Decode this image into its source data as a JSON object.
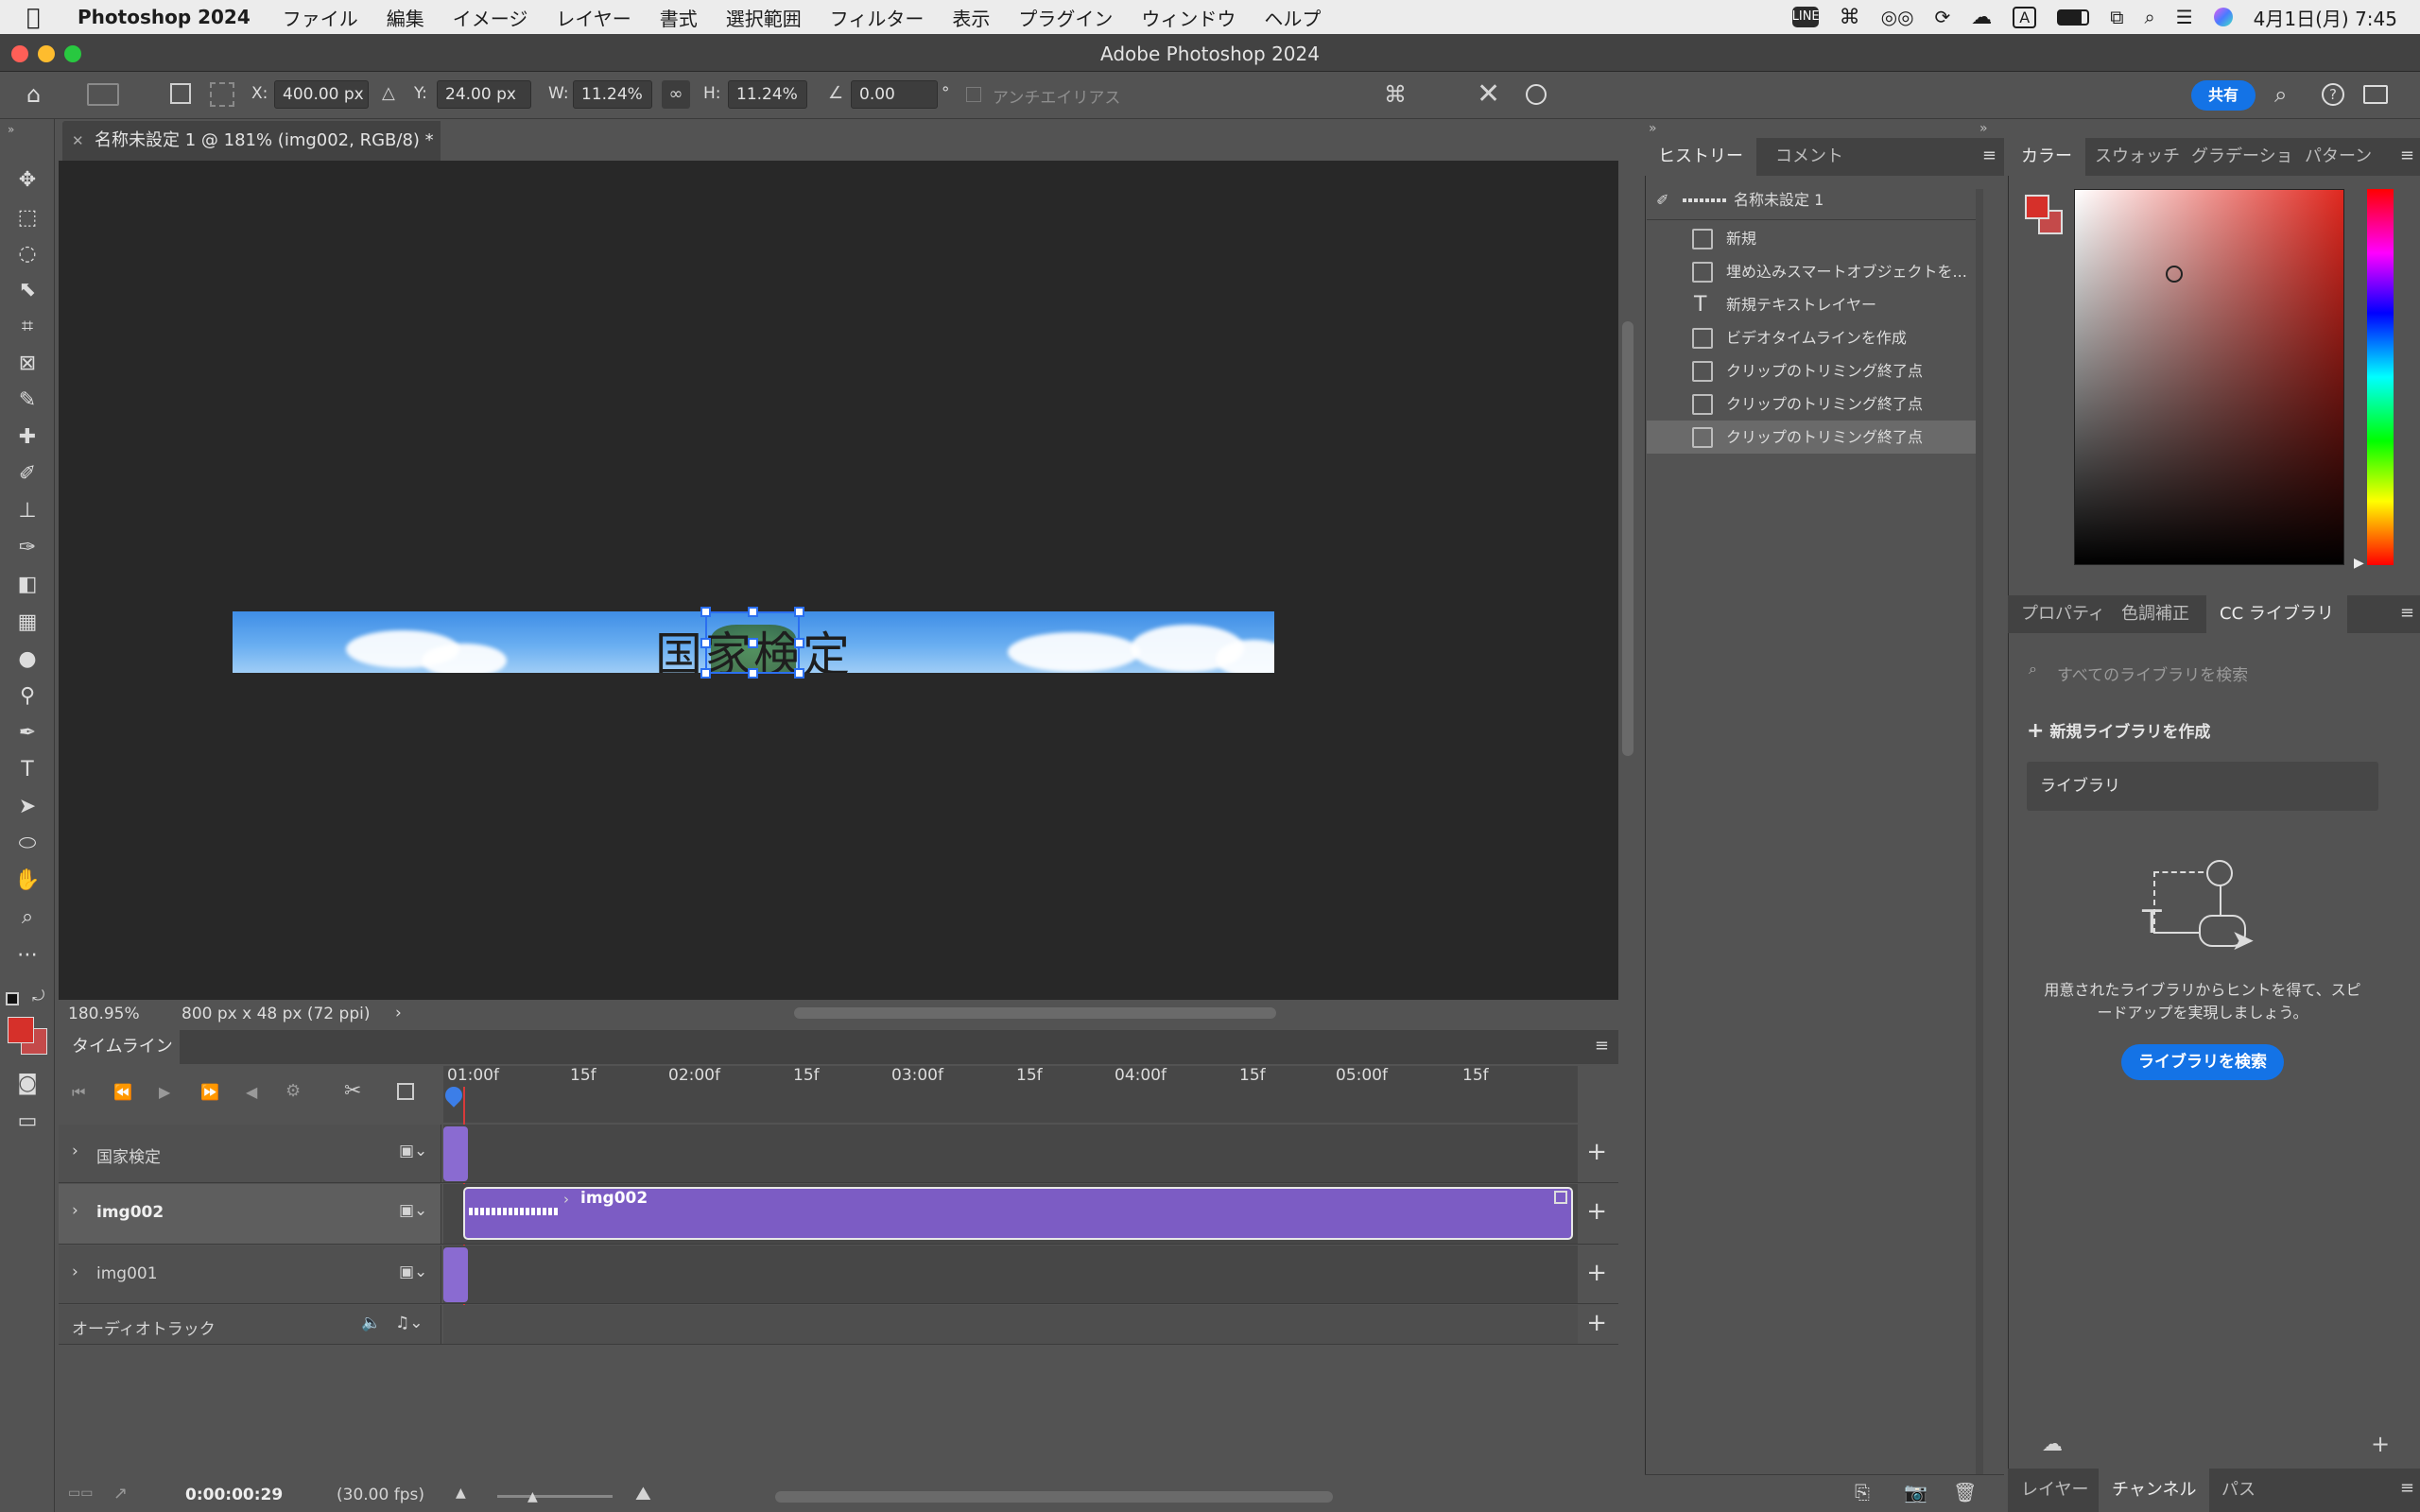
{
  "menubar": {
    "app_name": "Photoshop 2024",
    "items": [
      "ファイル",
      "編集",
      "イメージ",
      "レイヤー",
      "書式",
      "選択範囲",
      "フィルター",
      "表示",
      "プラグイン",
      "ウィンドウ",
      "ヘルプ"
    ],
    "clock": "4月1日(月) 7:45",
    "input_indicator": "A"
  },
  "window": {
    "title": "Adobe Photoshop 2024"
  },
  "options": {
    "x_label": "X:",
    "x_value": "400.00 px",
    "y_label": "Y:",
    "y_value": "24.00 px",
    "w_label": "W:",
    "w_value": "11.24%",
    "h_label": "H:",
    "h_value": "11.24%",
    "angle_value": "0.00",
    "degree": "°",
    "antialias": "アンチエイリアス",
    "share": "共有"
  },
  "document": {
    "tab_title": "名称未設定 1 @ 181% (img002, RGB/8) *",
    "image_text": "国家検定",
    "zoom": "180.95%",
    "size": "800 px x 48 px (72 ppi)"
  },
  "timeline": {
    "tab": "タイムライン",
    "ruler": [
      "01:00f",
      "15f",
      "02:00f",
      "15f",
      "03:00f",
      "15f",
      "04:00f",
      "15f",
      "05:00f",
      "15f"
    ],
    "tracks": [
      {
        "name": "国家検定"
      },
      {
        "name": "img002",
        "clip": "img002"
      },
      {
        "name": "img001"
      },
      {
        "name": "オーディオトラック"
      }
    ],
    "timecode": "0:00:00:29",
    "fps": "(30.00 fps)"
  },
  "history": {
    "tabs": [
      "ヒストリー",
      "コメント"
    ],
    "snapshot": "名称未設定 1",
    "items": [
      "新規",
      "埋め込みスマートオブジェクトを...",
      "新規テキストレイヤー",
      "ビデオタイムラインを作成",
      "クリップのトリミング終了点",
      "クリップのトリミング終了点",
      "クリップのトリミング終了点"
    ]
  },
  "color_panel": {
    "tabs": [
      "カラー",
      "スウォッチ",
      "グラデーショ",
      "パターン"
    ],
    "foreground": "#d6302a",
    "background": "#c44a4a"
  },
  "libraries": {
    "tabs": [
      "プロパティ",
      "色調補正",
      "CC ライブラリ"
    ],
    "search_placeholder": "すべてのライブラリを検索",
    "new_library": "新規ライブラリを作成",
    "library": "ライブラリ",
    "hint": "用意されたライブラリからヒントを得て、スピードアップを実現しましょう。",
    "search_button": "ライブラリを検索"
  },
  "bottom_tabs": [
    "レイヤー",
    "チャンネル",
    "パス"
  ]
}
